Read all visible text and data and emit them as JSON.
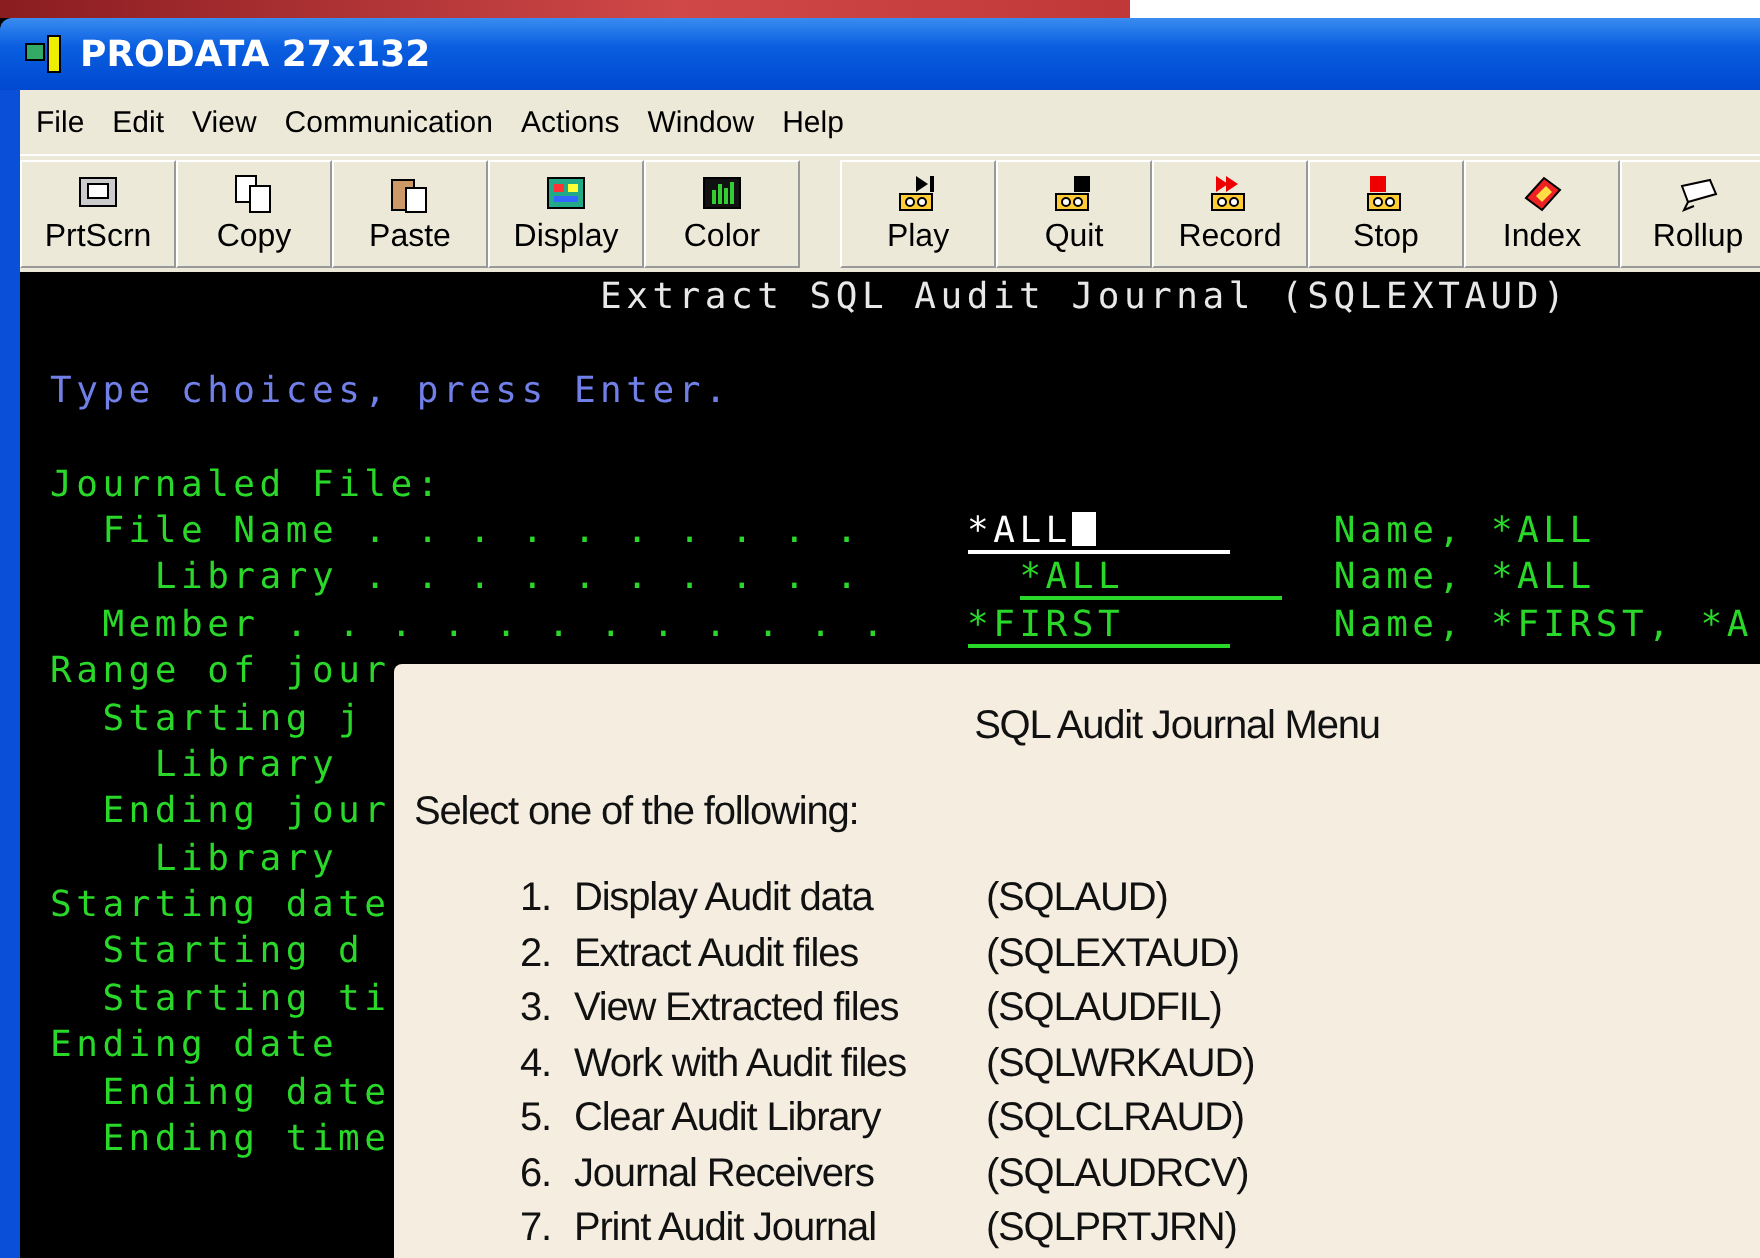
{
  "window": {
    "title": "PRODATA 27x132"
  },
  "menu": [
    "File",
    "Edit",
    "View",
    "Communication",
    "Actions",
    "Window",
    "Help"
  ],
  "toolbar": {
    "groups": [
      [
        {
          "label": "PrtScrn"
        },
        {
          "label": "Copy"
        },
        {
          "label": "Paste"
        },
        {
          "label": "Display"
        },
        {
          "label": "Color"
        }
      ],
      [
        {
          "label": "Play"
        },
        {
          "label": "Quit"
        },
        {
          "label": "Record"
        },
        {
          "label": "Stop"
        },
        {
          "label": "Index"
        },
        {
          "label": "Rollup"
        }
      ]
    ]
  },
  "terminal": {
    "title": "Extract SQL Audit Journal (SQLEXTAUD)",
    "instruction": "Type choices, press Enter.",
    "prompts": [
      {
        "label": "Journaled File:",
        "children": [
          {
            "label": "File Name",
            "leader": ". . . . . . . . . .",
            "field": {
              "value": "*ALL",
              "focused": true
            },
            "hint": "Name, *ALL",
            "children": [
              {
                "label": "Library",
                "leader": ". . . . . . . . . .",
                "field": {
                  "value": "*ALL",
                  "focused": false
                },
                "hint": "Name, *ALL"
              }
            ]
          },
          {
            "label": "Member",
            "leader": ". . . . . . . . . . . .",
            "field": {
              "value": "*FIRST",
              "focused": false
            },
            "hint": "Name, *FIRST, *A"
          }
        ]
      },
      {
        "label": "Range of jour",
        "children": [
          {
            "label": "Starting j",
            "children": [
              {
                "label": "Library"
              }
            ]
          },
          {
            "label": "Ending jour",
            "children": [
              {
                "label": "Library"
              }
            ]
          }
        ]
      },
      {
        "label": "Starting date",
        "children": [
          {
            "label": "Starting d"
          },
          {
            "label": "Starting ti"
          }
        ]
      },
      {
        "label": "Ending date",
        "children": [
          {
            "label": "Ending date"
          },
          {
            "label": "Ending time"
          }
        ]
      }
    ]
  },
  "dialog": {
    "title": "SQL Audit Journal Menu",
    "prompt": "Select one of the following:",
    "options": [
      {
        "number": "1.",
        "label": "Display Audit data",
        "command": "(SQLAUD)"
      },
      {
        "number": "2.",
        "label": "Extract Audit files",
        "command": "(SQLEXTAUD)"
      },
      {
        "number": "3.",
        "label": "View Extracted files",
        "command": "(SQLAUDFIL)"
      },
      {
        "number": "4.",
        "label": "Work with Audit files",
        "command": "(SQLWRKAUD)"
      },
      {
        "number": "5.",
        "label": "Clear Audit Library",
        "command": "(SQLCLRAUD)"
      },
      {
        "number": "6.",
        "label": "Journal Receivers",
        "command": "(SQLAUDRCV)"
      },
      {
        "number": "7.",
        "label": "Print Audit Journal",
        "command": "(SQLPRTJRN)"
      }
    ]
  }
}
